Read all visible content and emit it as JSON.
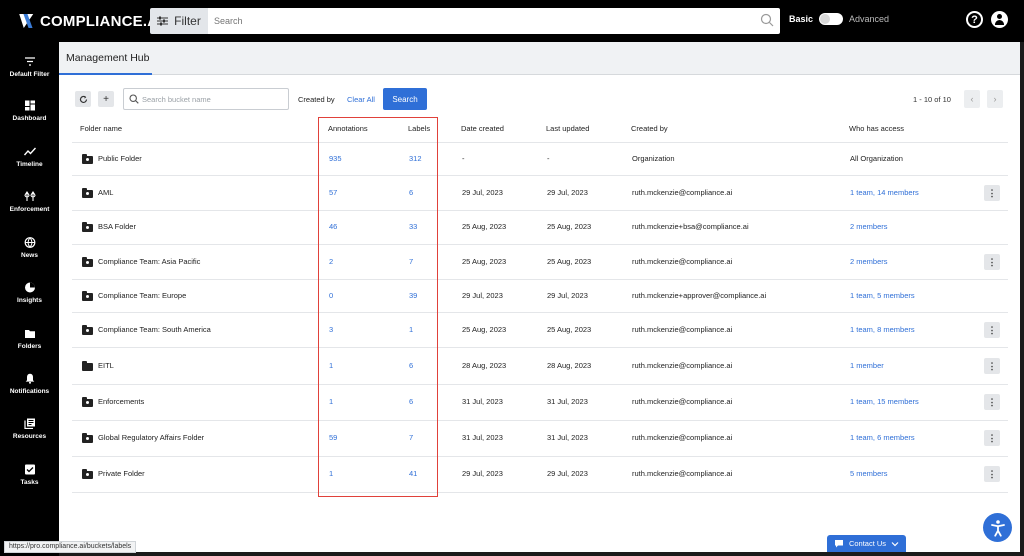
{
  "header": {
    "brand": "COMPLIANCE.AI",
    "filter_label": "Filter",
    "search_placeholder": "Search",
    "mode_basic": "Basic",
    "mode_advanced": "Advanced",
    "help_icon": "question-circle-icon",
    "user_icon": "account-circle-icon"
  },
  "sidebar": {
    "items": [
      {
        "label": "Default Filter",
        "icon": "filter-icon"
      },
      {
        "label": "Dashboard",
        "icon": "dashboard-icon"
      },
      {
        "label": "Timeline",
        "icon": "timeline-icon"
      },
      {
        "label": "Enforcement",
        "icon": "enforcement-icon"
      },
      {
        "label": "News",
        "icon": "globe-icon"
      },
      {
        "label": "Insights",
        "icon": "pie-chart-icon"
      },
      {
        "label": "Folders",
        "icon": "folder-icon"
      },
      {
        "label": "Notifications",
        "icon": "bell-icon"
      },
      {
        "label": "Resources",
        "icon": "library-icon"
      },
      {
        "label": "Tasks",
        "icon": "checkbox-icon"
      }
    ]
  },
  "page": {
    "title": "Management Hub"
  },
  "toolbar": {
    "refresh_icon": "refresh-icon",
    "add_icon": "plus-icon",
    "search_placeholder": "Search bucket name",
    "created_by_label": "Created by",
    "clear_all_label": "Clear All",
    "search_button": "Search",
    "pagination_text": "1 - 10 of 10"
  },
  "table": {
    "columns": [
      "Folder name",
      "Annotations",
      "Labels",
      "Date created",
      "Last updated",
      "Created by",
      "Who has access"
    ],
    "rows": [
      {
        "name": "Public Folder",
        "annotations": "935",
        "labels": "312",
        "created": "-",
        "updated": "-",
        "creator": "Organization",
        "access": "All Organization",
        "access_link": false,
        "menu": false,
        "shared": true
      },
      {
        "name": "AML",
        "annotations": "57",
        "labels": "6",
        "created": "29 Jul, 2023",
        "updated": "29 Jul, 2023",
        "creator": "ruth.mckenzie@compliance.ai",
        "access": "1 team, 14 members",
        "access_link": true,
        "menu": true,
        "shared": true
      },
      {
        "name": "BSA Folder",
        "annotations": "46",
        "labels": "33",
        "created": "25 Aug, 2023",
        "updated": "25 Aug, 2023",
        "creator": "ruth.mckenzie+bsa@compliance.ai",
        "access": "2 members",
        "access_link": true,
        "menu": false,
        "shared": true
      },
      {
        "name": "Compliance Team: Asia Pacific",
        "annotations": "2",
        "labels": "7",
        "created": "25 Aug, 2023",
        "updated": "25 Aug, 2023",
        "creator": "ruth.mckenzie@compliance.ai",
        "access": "2 members",
        "access_link": true,
        "menu": true,
        "shared": true
      },
      {
        "name": "Compliance Team: Europe",
        "annotations": "0",
        "labels": "39",
        "created": "29 Jul, 2023",
        "updated": "29 Jul, 2023",
        "creator": "ruth.mckenzie+approver@compliance.ai",
        "access": "1 team, 5 members",
        "access_link": true,
        "menu": false,
        "shared": true
      },
      {
        "name": "Compliance Team: South America",
        "annotations": "3",
        "labels": "1",
        "created": "25 Aug, 2023",
        "updated": "25 Aug, 2023",
        "creator": "ruth.mckenzie@compliance.ai",
        "access": "1 team, 8 members",
        "access_link": true,
        "menu": true,
        "shared": true
      },
      {
        "name": "EITL",
        "annotations": "1",
        "labels": "6",
        "created": "28 Aug, 2023",
        "updated": "28 Aug, 2023",
        "creator": "ruth.mckenzie@compliance.ai",
        "access": "1 member",
        "access_link": true,
        "menu": true,
        "shared": false
      },
      {
        "name": "Enforcements",
        "annotations": "1",
        "labels": "6",
        "created": "31 Jul, 2023",
        "updated": "31 Jul, 2023",
        "creator": "ruth.mckenzie@compliance.ai",
        "access": "1 team, 15 members",
        "access_link": true,
        "menu": true,
        "shared": true
      },
      {
        "name": "Global Regulatory Affairs Folder",
        "annotations": "59",
        "labels": "7",
        "created": "31 Jul, 2023",
        "updated": "31 Jul, 2023",
        "creator": "ruth.mckenzie@compliance.ai",
        "access": "1 team, 6 members",
        "access_link": true,
        "menu": true,
        "shared": true
      },
      {
        "name": "Private Folder",
        "annotations": "1",
        "labels": "41",
        "created": "29 Jul, 2023",
        "updated": "29 Jul, 2023",
        "creator": "ruth.mckenzie@compliance.ai",
        "access": "5 members",
        "access_link": true,
        "menu": true,
        "shared": true
      }
    ]
  },
  "status_url": "https://pro.compliance.ai/buckets/labels",
  "contact_us": "Contact Us",
  "colors": {
    "accent": "#2f6fd7",
    "highlight": "#e0413a",
    "sidebar": "#000000"
  }
}
